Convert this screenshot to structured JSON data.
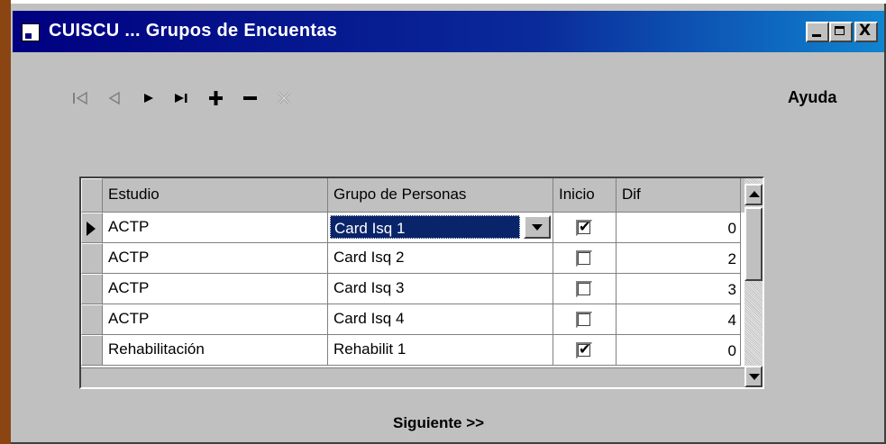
{
  "window": {
    "title": "CUISCU ... Grupos de Encuentas",
    "controls": [
      "minimize",
      "maximize",
      "close"
    ],
    "close_glyph": "X"
  },
  "toolbar": {
    "nav_buttons": [
      {
        "name": "first-record",
        "icon": "first-icon",
        "enabled": false
      },
      {
        "name": "previous-record",
        "icon": "previous-icon",
        "enabled": false
      },
      {
        "name": "next-record",
        "icon": "next-icon",
        "enabled": true
      },
      {
        "name": "last-record",
        "icon": "last-icon",
        "enabled": true
      },
      {
        "name": "add-record",
        "icon": "plus-icon",
        "enabled": true
      },
      {
        "name": "delete-record",
        "icon": "minus-icon",
        "enabled": true
      },
      {
        "name": "cancel-record",
        "icon": "cancel-icon",
        "enabled": false
      }
    ],
    "help_label": "Ayuda"
  },
  "grid": {
    "columns": [
      "Estudio",
      "Grupo de Personas",
      "Inicio",
      "Dif"
    ],
    "rows": [
      {
        "estudio": "ACTP",
        "grupo": "Card Isq 1",
        "inicio": true,
        "dif": "0",
        "current": true
      },
      {
        "estudio": "ACTP",
        "grupo": "Card Isq 2",
        "inicio": false,
        "dif": "2",
        "current": false
      },
      {
        "estudio": "ACTP",
        "grupo": "Card Isq 3",
        "inicio": false,
        "dif": "3",
        "current": false
      },
      {
        "estudio": "ACTP",
        "grupo": "Card Isq 4",
        "inicio": false,
        "dif": "4",
        "current": false
      },
      {
        "estudio": "Rehabilitación",
        "grupo": "Rehabilit 1",
        "inicio": true,
        "dif": "0",
        "current": false
      }
    ],
    "check_glyph": "✔"
  },
  "footer": {
    "next_label": "Siguiente >>"
  },
  "colors": {
    "titlebar_start": "#000080",
    "titlebar_end": "#1084d0",
    "face": "#c0c0c0",
    "selection": "#0a246a",
    "outer_border": "#8b4513"
  }
}
